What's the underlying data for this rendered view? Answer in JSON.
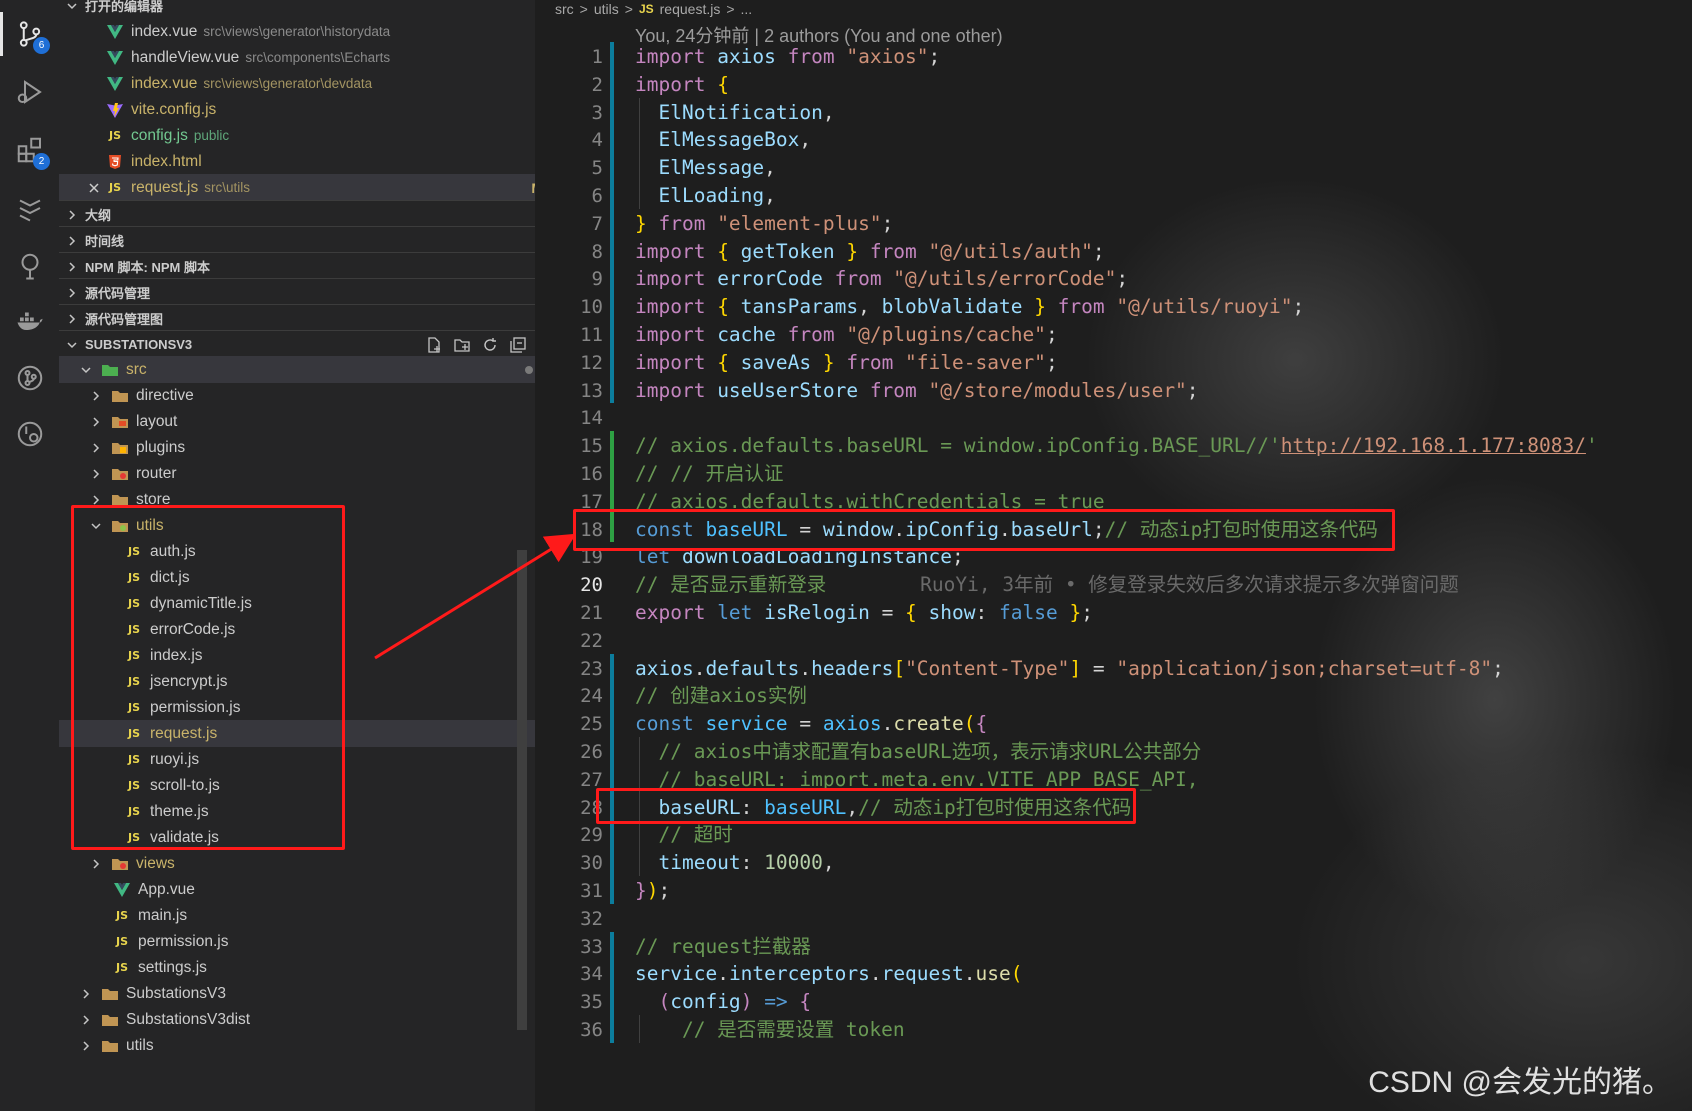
{
  "activity_bar": {
    "source_control_badge": "6",
    "extensions_badge": "2"
  },
  "open_editors": {
    "header": "打开的编辑器",
    "items": [
      {
        "name": "index.vue",
        "path": "src\\views\\generator\\historydata",
        "status": ""
      },
      {
        "name": "handleView.vue",
        "path": "src\\components\\Echarts",
        "status": ""
      },
      {
        "name": "index.vue",
        "path": "src\\views\\generator\\devdata",
        "status": "M"
      },
      {
        "name": "vite.config.js",
        "path": "",
        "status": "M"
      },
      {
        "name": "config.js",
        "path": "public",
        "status": "U"
      },
      {
        "name": "index.html",
        "path": "",
        "status": "M"
      },
      {
        "name": "request.js",
        "path": "src\\utils",
        "status": "M"
      }
    ]
  },
  "panels": [
    "大纲",
    "时间线",
    "NPM 脚本: NPM 脚本",
    "源代码管理",
    "源代码管理图"
  ],
  "explorer": {
    "root": "SUBSTATIONSV3",
    "src": "src",
    "src_children": [
      "directive",
      "layout",
      "plugins",
      "router",
      "store"
    ],
    "utils": "utils",
    "utils_files": [
      "auth.js",
      "dict.js",
      "dynamicTitle.js",
      "errorCode.js",
      "index.js",
      "jsencrypt.js",
      "permission.js",
      "request.js",
      "ruoyi.js",
      "scroll-to.js",
      "theme.js",
      "validate.js"
    ],
    "request_status": "M",
    "views": "views",
    "src_files": [
      "App.vue",
      "main.js",
      "permission.js",
      "settings.js"
    ],
    "root_folders": [
      "SubstationsV3",
      "SubstationsV3dist",
      "utils"
    ]
  },
  "editor": {
    "breadcrumb": [
      "src",
      ">",
      "utils",
      ">",
      "JS",
      "request.js",
      ">",
      "..."
    ],
    "blame": "You, 24分钟前 | 2 authors (You and one other)",
    "lines": [
      {
        "n": "1",
        "t": [
          [
            "kw",
            "import "
          ],
          [
            "id",
            "axios "
          ],
          [
            "kw",
            "from "
          ],
          [
            "str",
            "\"axios\""
          ],
          [
            "pl",
            ";"
          ]
        ]
      },
      {
        "n": "2",
        "t": [
          [
            "kw",
            "import "
          ],
          [
            "br",
            "{"
          ]
        ]
      },
      {
        "n": "3",
        "t": [
          [
            "pl",
            "  "
          ],
          [
            "id",
            "ElNotification"
          ],
          [
            "pl",
            ","
          ]
        ]
      },
      {
        "n": "4",
        "t": [
          [
            "pl",
            "  "
          ],
          [
            "id",
            "ElMessageBox"
          ],
          [
            "pl",
            ","
          ]
        ]
      },
      {
        "n": "5",
        "t": [
          [
            "pl",
            "  "
          ],
          [
            "id",
            "ElMessage"
          ],
          [
            "pl",
            ","
          ]
        ]
      },
      {
        "n": "6",
        "t": [
          [
            "pl",
            "  "
          ],
          [
            "id",
            "ElLoading"
          ],
          [
            "pl",
            ","
          ]
        ]
      },
      {
        "n": "7",
        "t": [
          [
            "br",
            "} "
          ],
          [
            "kw",
            "from "
          ],
          [
            "str",
            "\"element-plus\""
          ],
          [
            "pl",
            ";"
          ]
        ]
      },
      {
        "n": "8",
        "t": [
          [
            "kw",
            "import "
          ],
          [
            "br",
            "{ "
          ],
          [
            "id",
            "getToken "
          ],
          [
            "br",
            "} "
          ],
          [
            "kw",
            "from "
          ],
          [
            "str",
            "\"@/utils/auth\""
          ],
          [
            "pl",
            ";"
          ]
        ]
      },
      {
        "n": "9",
        "t": [
          [
            "kw",
            "import "
          ],
          [
            "id",
            "errorCode "
          ],
          [
            "kw",
            "from "
          ],
          [
            "str",
            "\"@/utils/errorCode\""
          ],
          [
            "pl",
            ";"
          ]
        ]
      },
      {
        "n": "10",
        "t": [
          [
            "kw",
            "import "
          ],
          [
            "br",
            "{ "
          ],
          [
            "id",
            "tansParams"
          ],
          [
            "pl",
            ", "
          ],
          [
            "id",
            "blobValidate "
          ],
          [
            "br",
            "} "
          ],
          [
            "kw",
            "from "
          ],
          [
            "str",
            "\"@/utils/ruoyi\""
          ],
          [
            "pl",
            ";"
          ]
        ]
      },
      {
        "n": "11",
        "t": [
          [
            "kw",
            "import "
          ],
          [
            "id",
            "cache "
          ],
          [
            "kw",
            "from "
          ],
          [
            "str",
            "\"@/plugins/cache\""
          ],
          [
            "pl",
            ";"
          ]
        ]
      },
      {
        "n": "12",
        "t": [
          [
            "kw",
            "import "
          ],
          [
            "br",
            "{ "
          ],
          [
            "id",
            "saveAs "
          ],
          [
            "br",
            "} "
          ],
          [
            "kw",
            "from "
          ],
          [
            "str",
            "\"file-saver\""
          ],
          [
            "pl",
            ";"
          ]
        ]
      },
      {
        "n": "13",
        "t": [
          [
            "kw",
            "import "
          ],
          [
            "id",
            "useUserStore "
          ],
          [
            "kw",
            "from "
          ],
          [
            "str",
            "\"@/store/modules/user\""
          ],
          [
            "pl",
            ";"
          ]
        ]
      },
      {
        "n": "14",
        "t": []
      },
      {
        "n": "15",
        "t": [
          [
            "com",
            "// axios.defaults.baseURL = window.ipConfig.BASE_URL//'"
          ],
          [
            "lnk",
            "http://192.168.1.177:8083/"
          ],
          [
            "com",
            "'"
          ]
        ]
      },
      {
        "n": "16",
        "t": [
          [
            "com",
            "// // 开启认证"
          ]
        ]
      },
      {
        "n": "17",
        "t": [
          [
            "com",
            "// axios.defaults.withCredentials = true"
          ]
        ]
      },
      {
        "n": "18",
        "t": [
          [
            "bl",
            "const "
          ],
          [
            "cn",
            "baseURL "
          ],
          [
            "pl",
            "= "
          ],
          [
            "id",
            "window"
          ],
          [
            "pl",
            "."
          ],
          [
            "id",
            "ipConfig"
          ],
          [
            "pl",
            "."
          ],
          [
            "id",
            "baseUrl"
          ],
          [
            "pl",
            ";"
          ],
          [
            "com",
            "// 动态ip打包时使用这条代码"
          ]
        ]
      },
      {
        "n": "19",
        "t": [
          [
            "bl",
            "let "
          ],
          [
            "id",
            "downloadLoadingInstance"
          ],
          [
            "pl",
            ";"
          ]
        ]
      },
      {
        "n": "20",
        "t": [
          [
            "com",
            "// 是否显示重新登录"
          ],
          [
            "gh",
            "        RuoYi, 3年前 • 修复登录失效后多次请求提示多次弹窗问题"
          ]
        ]
      },
      {
        "n": "21",
        "t": [
          [
            "kw",
            "export "
          ],
          [
            "bl",
            "let "
          ],
          [
            "id",
            "isRelogin "
          ],
          [
            "pl",
            "= "
          ],
          [
            "br",
            "{ "
          ],
          [
            "id",
            "show"
          ],
          [
            "pl",
            ": "
          ],
          [
            "bl",
            "false "
          ],
          [
            "br",
            "}"
          ],
          [
            "pl",
            ";"
          ]
        ]
      },
      {
        "n": "22",
        "t": []
      },
      {
        "n": "23",
        "t": [
          [
            "id",
            "axios"
          ],
          [
            "pl",
            "."
          ],
          [
            "id",
            "defaults"
          ],
          [
            "pl",
            "."
          ],
          [
            "id",
            "headers"
          ],
          [
            "br",
            "["
          ],
          [
            "str",
            "\"Content-Type\""
          ],
          [
            "br",
            "]"
          ],
          [
            "pl",
            " = "
          ],
          [
            "str",
            "\"application/json;charset=utf-8\""
          ],
          [
            "pl",
            ";"
          ]
        ]
      },
      {
        "n": "24",
        "t": [
          [
            "com",
            "// 创建axios实例"
          ]
        ]
      },
      {
        "n": "25",
        "t": [
          [
            "bl",
            "const "
          ],
          [
            "cn",
            "service "
          ],
          [
            "pl",
            "= "
          ],
          [
            "cn",
            "axios"
          ],
          [
            "pl",
            "."
          ],
          [
            "fn",
            "create"
          ],
          [
            "br",
            "("
          ],
          [
            "kw",
            "{"
          ]
        ]
      },
      {
        "n": "26",
        "t": [
          [
            "pl",
            "  "
          ],
          [
            "com",
            "// axios中请求配置有baseURL选项，表示请求URL公共部分"
          ]
        ]
      },
      {
        "n": "27",
        "t": [
          [
            "pl",
            "  "
          ],
          [
            "com",
            "// baseURL: import.meta.env.VITE_APP_BASE_API,"
          ]
        ]
      },
      {
        "n": "28",
        "t": [
          [
            "pl",
            "  "
          ],
          [
            "id",
            "baseURL"
          ],
          [
            "pl",
            ": "
          ],
          [
            "cn",
            "baseURL"
          ],
          [
            "pl",
            ","
          ],
          [
            "com",
            "// 动态ip打包时使用这条代码"
          ]
        ]
      },
      {
        "n": "29",
        "t": [
          [
            "pl",
            "  "
          ],
          [
            "com",
            "// 超时"
          ]
        ]
      },
      {
        "n": "30",
        "t": [
          [
            "pl",
            "  "
          ],
          [
            "id",
            "timeout"
          ],
          [
            "pl",
            ": "
          ],
          [
            "num",
            "10000"
          ],
          [
            "pl",
            ","
          ]
        ]
      },
      {
        "n": "31",
        "t": [
          [
            "kw",
            "}"
          ],
          [
            "br",
            ")"
          ],
          [
            "pl",
            ";"
          ]
        ]
      },
      {
        "n": "32",
        "t": []
      },
      {
        "n": "33",
        "t": [
          [
            "com",
            "// request拦截器"
          ]
        ]
      },
      {
        "n": "34",
        "t": [
          [
            "id",
            "service"
          ],
          [
            "pl",
            "."
          ],
          [
            "id",
            "interceptors"
          ],
          [
            "pl",
            "."
          ],
          [
            "id",
            "request"
          ],
          [
            "pl",
            "."
          ],
          [
            "fn",
            "use"
          ],
          [
            "br",
            "("
          ]
        ]
      },
      {
        "n": "35",
        "t": [
          [
            "pl",
            "  "
          ],
          [
            "kw",
            "("
          ],
          [
            "id",
            "config"
          ],
          [
            "kw",
            ")"
          ],
          [
            "pl",
            " "
          ],
          [
            "bl",
            "=> "
          ],
          [
            "kw",
            "{"
          ]
        ]
      },
      {
        "n": "36",
        "t": [
          [
            "pl",
            "    "
          ],
          [
            "com",
            "// 是否需要设置 token"
          ]
        ]
      }
    ],
    "current_line": "20"
  },
  "watermark": "CSDN @会发光的猪。"
}
